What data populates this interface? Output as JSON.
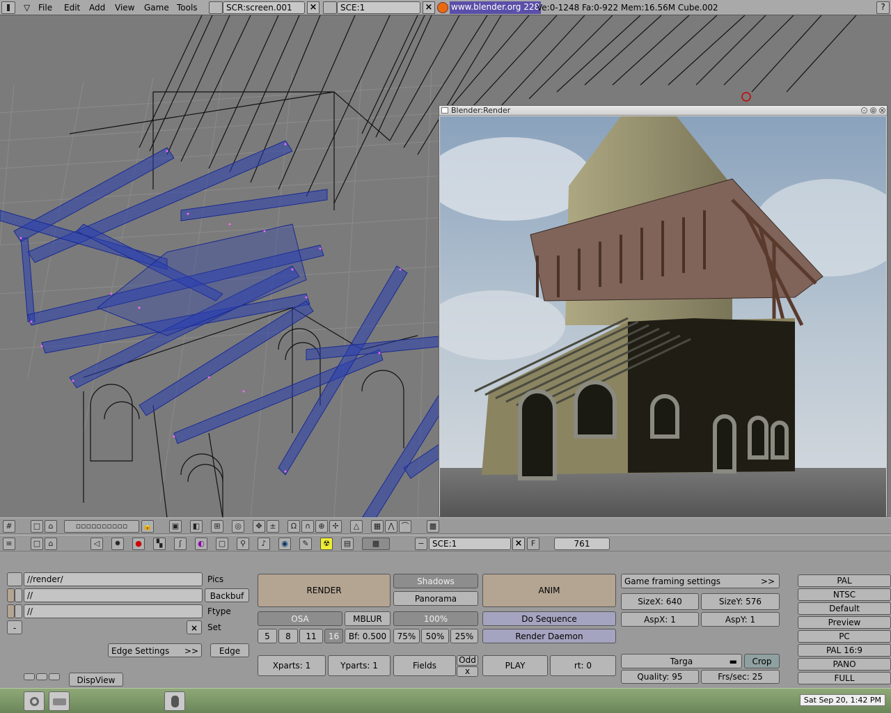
{
  "header": {
    "menus": [
      "File",
      "Edit",
      "Add",
      "View",
      "Game",
      "Tools"
    ],
    "screen_field": "SCR:screen.001",
    "scene_field": "SCE:1",
    "url": "www.blender.org 228",
    "stats": "Ve:0-1248 Fa:0-922  Mem:16.56M  Cube.002"
  },
  "render_window": {
    "title": "Blender:Render"
  },
  "buttons_header": {
    "scene": "SCE:1",
    "frame_label": "F",
    "frame": "761"
  },
  "output": {
    "pics_path": "//render/",
    "backbuf_path": "//",
    "ftype_path": "//",
    "pics_label": "Pics",
    "backbuf_label": "Backbuf",
    "ftype_label": "Ftype",
    "set_label": "Set",
    "edge_settings": "Edge Settings",
    "edge_arrows": ">>",
    "edge": "Edge",
    "dispview": "DispView"
  },
  "render": {
    "render": "RENDER",
    "shadows": "Shadows",
    "panorama": "Panorama",
    "anim": "ANIM",
    "osa": "OSA",
    "mblur": "MBLUR",
    "size_pct": "100%",
    "do_sequence": "Do Sequence",
    "osa_levels": [
      "5",
      "8",
      "11",
      "16"
    ],
    "bf": "Bf: 0.500",
    "pcts": [
      "75%",
      "50%",
      "25%"
    ],
    "render_daemon": "Render Daemon",
    "xparts": "Xparts: 1",
    "yparts": "Yparts: 1",
    "fields": "Fields",
    "odd": "Odd",
    "x": "x",
    "play": "PLAY",
    "rt": "rt: 0"
  },
  "format": {
    "game_framing": "Game framing settings",
    "game_arrows": ">>",
    "sizex": "SizeX: 640",
    "sizey": "SizeY: 576",
    "aspx": "AspX: 1",
    "aspy": "AspY: 1",
    "filetype": "Targa",
    "crop": "Crop",
    "quality": "Quality: 95",
    "fps": "Frs/sec: 25"
  },
  "presets": [
    "PAL",
    "NTSC",
    "Default",
    "Preview",
    "PC",
    "PAL 16:9",
    "PANO",
    "FULL"
  ],
  "taskbar": {
    "clock": "Sat Sep 20,  1:42 PM"
  },
  "colors": {
    "viewport_bg": "#7b7b7b",
    "selection_blue": "#2a3fb0",
    "vertex_pink": "#ff66ff",
    "render_button": "#b4a492",
    "blue_button": "#a4a4c0"
  }
}
